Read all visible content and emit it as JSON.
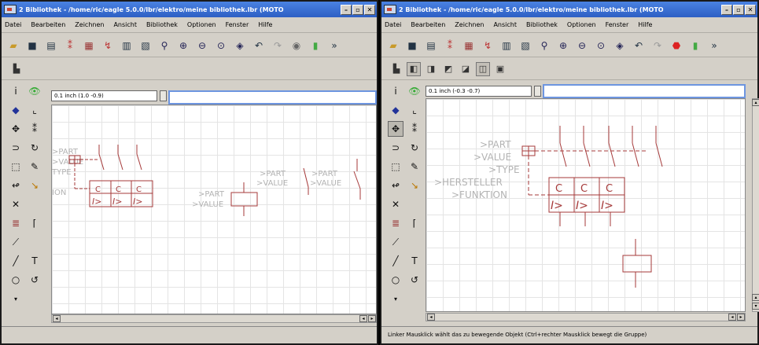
{
  "window_left": {
    "title": "2 Bibliothek - /home/ric/eagle 5.0.0/lbr/elektro/meine bibliothek.lbr (MOTO",
    "coord_readout": "0.1 inch (1.0 -0.9)",
    "labels": {
      "part": ">PART",
      "value": ">VALUE",
      "type": "TYPE",
      "tion": "ION"
    }
  },
  "window_right": {
    "title": "2 Bibliothek - /home/ric/eagle 5.0.0/lbr/elektro/meine bibliothek.lbr (MOTO",
    "coord_readout": "0.1 inch (-0.3 -0.7)",
    "status": "Linker Mausklick wählt das zu bewegende Objekt (Ctrl+rechter Mausklick bewegt die Gruppe)",
    "labels": {
      "part": ">PART",
      "value": ">VALUE",
      "type": ">TYPE",
      "hersteller": ">HERSTELLER",
      "funktion": ">FUNKTION"
    }
  },
  "menu": [
    "Datei",
    "Bearbeiten",
    "Zeichnen",
    "Ansicht",
    "Bibliothek",
    "Optionen",
    "Fenster",
    "Hilfe"
  ],
  "title_buttons": {
    "minimize": "–",
    "restore": "▫",
    "close": "✕"
  },
  "toolbar_icons": [
    "open-icon",
    "save-icon",
    "print-icon",
    "cam-icon",
    "board-icon",
    "schematic-icon",
    "script-icon",
    "run-icon",
    "zoom-fit-icon",
    "zoom-in-icon",
    "zoom-out-icon",
    "zoom-redraw-icon",
    "zoom-select-icon",
    "undo-icon",
    "redo-icon",
    "stop-icon",
    "go-icon"
  ],
  "more_glyph": "»",
  "symbol_text": {
    "ovr": "I>",
    "c": "C"
  },
  "colors": {
    "title": "#2d5fc4",
    "symbol": "#a63a3a",
    "command_focus": "#6d95e0",
    "grid": "#e4e4e4",
    "ghost_text": "#b3b3b3"
  }
}
